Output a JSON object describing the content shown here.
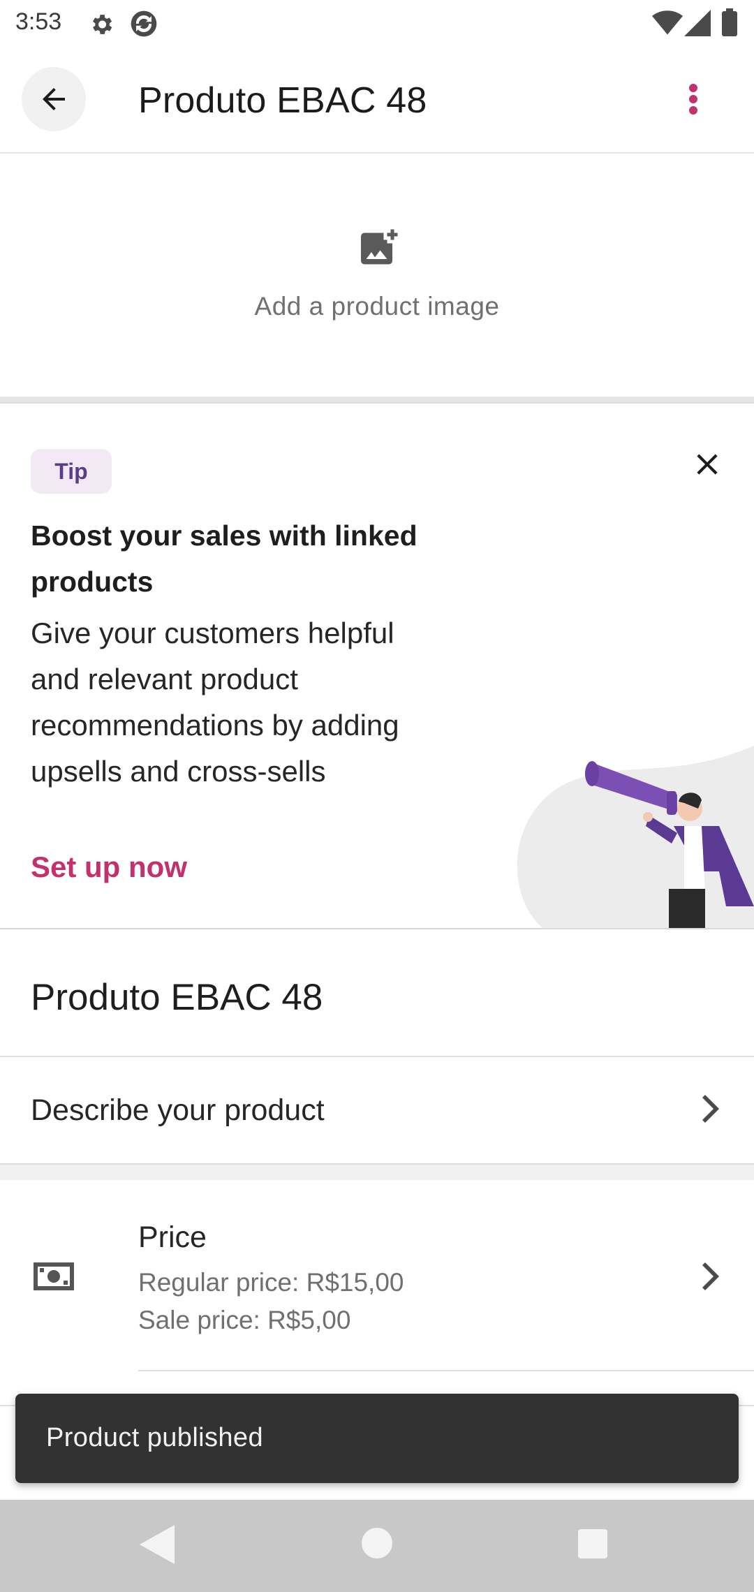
{
  "status_bar": {
    "time": "3:53",
    "icons": [
      "gear-icon",
      "sync-icon",
      "wifi-icon",
      "signal-icon",
      "battery-icon"
    ]
  },
  "app_bar": {
    "title": "Produto EBAC 48",
    "back_icon": "arrow-back-icon",
    "menu_icon": "more-vert-icon",
    "accent_color": "#c2306d"
  },
  "image_section": {
    "icon": "add-photo-icon",
    "label": "Add a product image"
  },
  "tip_card": {
    "badge": "Tip",
    "title": "Boost your sales with linked products",
    "body": "Give your customers helpful and relevant product recommendations by adding upsells and cross-sells",
    "action": "Set up now",
    "close_icon": "close-icon",
    "illustration": "megaphone-person-illustration"
  },
  "product": {
    "name": "Produto EBAC 48",
    "describe_label": "Describe your product"
  },
  "price": {
    "title": "Price",
    "regular": "Regular price: R$15,00",
    "sale": "Sale price: R$5,00",
    "icon": "money-icon"
  },
  "snackbar": {
    "message": "Product published"
  },
  "nav_bar": {
    "buttons": [
      "back-triangle-icon",
      "home-circle-icon",
      "recents-square-icon"
    ]
  }
}
